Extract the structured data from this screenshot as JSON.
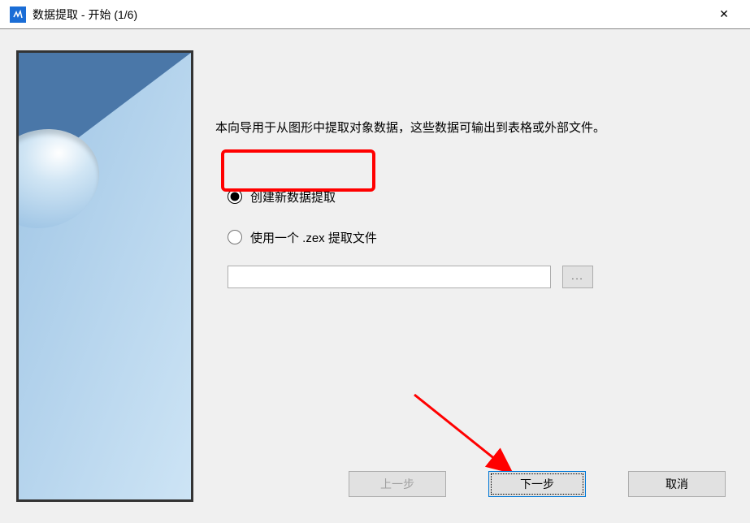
{
  "titlebar": {
    "title": "数据提取 - 开始 (1/6)",
    "close_label": "✕"
  },
  "main": {
    "description": "本向导用于从图形中提取对象数据，这些数据可输出到表格或外部文件。",
    "radio_create_new": "创建新数据提取",
    "radio_use_zex": "使用一个 .zex 提取文件",
    "file_path": "",
    "browse_label": "..."
  },
  "buttons": {
    "back": "上一步",
    "next": "下一步",
    "cancel": "取消"
  }
}
